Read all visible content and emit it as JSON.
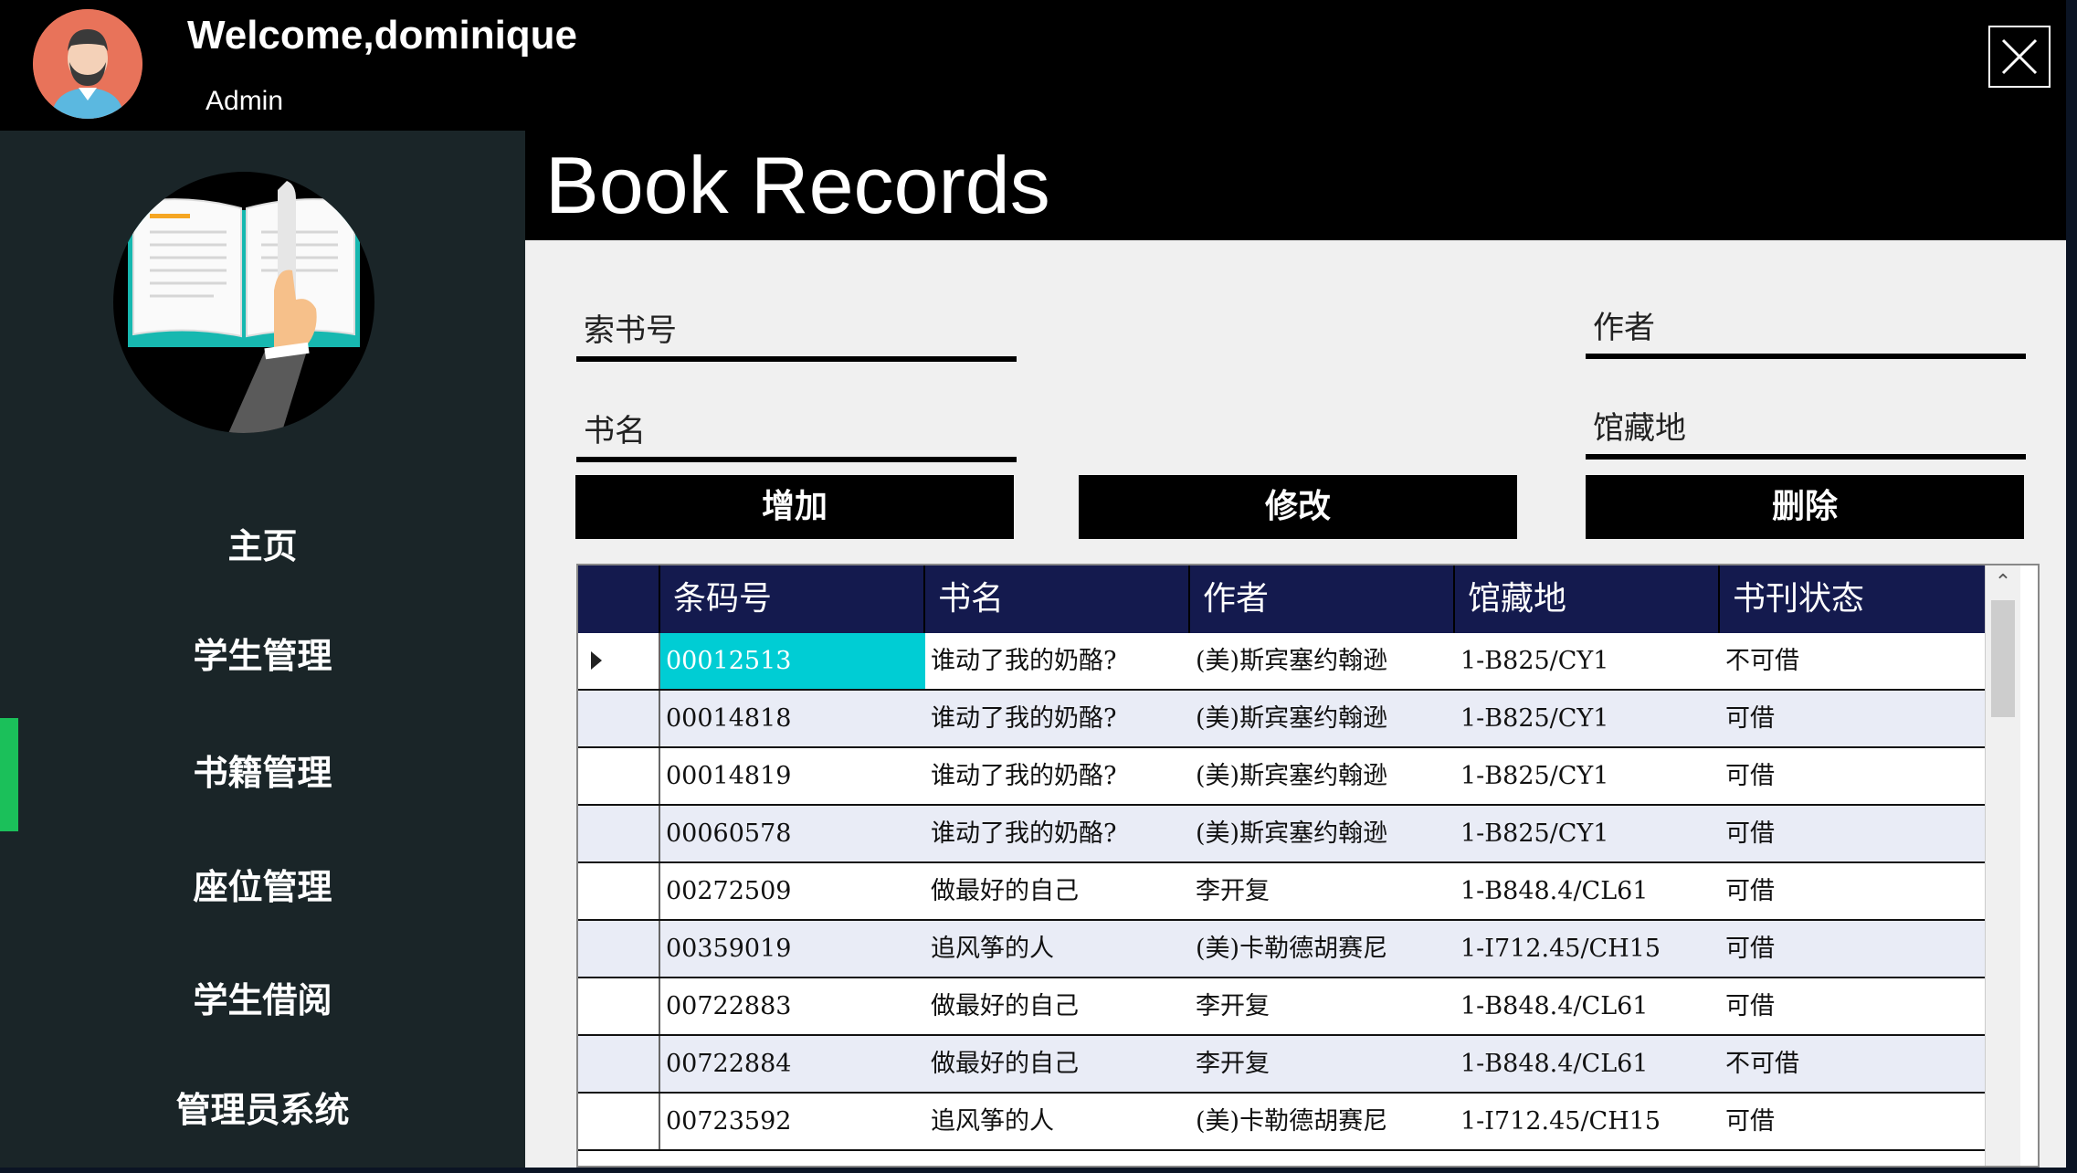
{
  "header": {
    "welcome_text": "Welcome,dominique",
    "role": "Admin"
  },
  "page": {
    "title": "Book Records"
  },
  "sidebar": {
    "items": [
      {
        "label": "主页"
      },
      {
        "label": "学生管理"
      },
      {
        "label": "书籍管理"
      },
      {
        "label": "座位管理"
      },
      {
        "label": "学生借阅"
      },
      {
        "label": "管理员系统"
      }
    ],
    "active_index": 2,
    "accent_color": "#1bc05a"
  },
  "form": {
    "call_number_label": "索书号",
    "author_label": "作者",
    "title_label": "书名",
    "location_label": "馆藏地"
  },
  "buttons": {
    "add": "增加",
    "edit": "修改",
    "delete": "删除"
  },
  "table": {
    "columns": [
      "条码号",
      "书名",
      "作者",
      "馆藏地",
      "书刊状态"
    ],
    "rows": [
      [
        "00012513",
        "谁动了我的奶酪?",
        "(美)斯宾塞约翰逊",
        "1-B825/CY1",
        "不可借"
      ],
      [
        "00014818",
        "谁动了我的奶酪?",
        "(美)斯宾塞约翰逊",
        "1-B825/CY1",
        "可借"
      ],
      [
        "00014819",
        "谁动了我的奶酪?",
        "(美)斯宾塞约翰逊",
        "1-B825/CY1",
        "可借"
      ],
      [
        "00060578",
        "谁动了我的奶酪?",
        "(美)斯宾塞约翰逊",
        "1-B825/CY1",
        "可借"
      ],
      [
        "00272509",
        "做最好的自己",
        "李开复",
        "1-B848.4/CL61",
        "可借"
      ],
      [
        "00359019",
        "追风筝的人",
        "(美)卡勒德胡赛尼",
        "1-I712.45/CH15",
        "可借"
      ],
      [
        "00722883",
        "做最好的自己",
        "李开复",
        "1-B848.4/CL61",
        "可借"
      ],
      [
        "00722884",
        "做最好的自己",
        "李开复",
        "1-B848.4/CL61",
        "不可借"
      ],
      [
        "00723592",
        "追风筝的人",
        "(美)卡勒德胡赛尼",
        "1-I712.45/CH15",
        "可借"
      ]
    ],
    "selected_row": 0,
    "header_color": "#141a4e",
    "selection_color": "#00cdd4"
  },
  "icons": {
    "close": "close-icon",
    "avatar": "user-avatar-icon",
    "logo": "book-logo-icon",
    "scroll_up": "chevron-up-icon"
  }
}
